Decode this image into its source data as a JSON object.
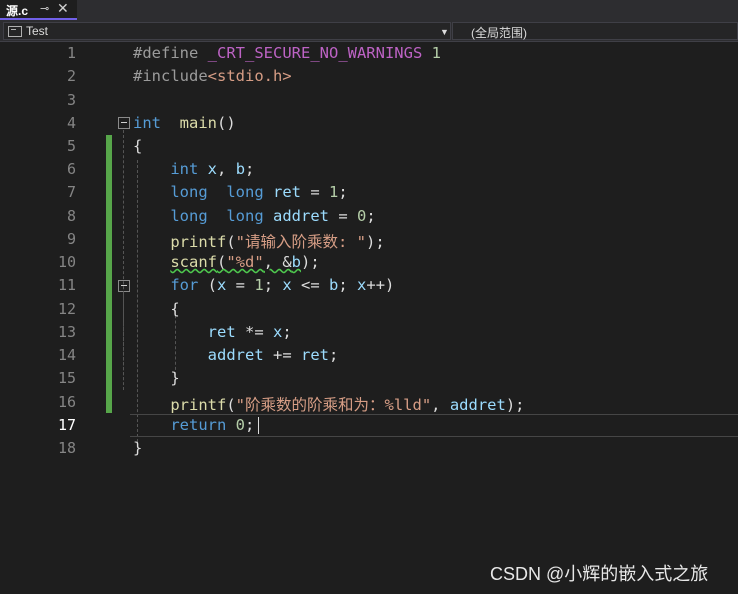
{
  "tab": {
    "title": "源.c",
    "pin": "⊸",
    "close": "✕"
  },
  "nav": {
    "project": "Test",
    "scope": "(全局范围)"
  },
  "line_numbers": [
    "1",
    "2",
    "3",
    "4",
    "5",
    "6",
    "7",
    "8",
    "9",
    "10",
    "11",
    "12",
    "13",
    "14",
    "15",
    "16",
    "17",
    "18"
  ],
  "current_line": "17",
  "code": {
    "l1_define": "#define",
    "l1_macro": "_CRT_SECURE_NO_WARNINGS",
    "l1_val": "1",
    "l2_include": "#include",
    "l2_header": "<stdio.h>",
    "l4_int": "int",
    "l4_main": "main",
    "l4_paren": "()",
    "l5_brace": "{",
    "l6_int": "int",
    "l6_x": "x",
    "l6_comma": ", ",
    "l6_b": "b",
    "l6_semi": ";",
    "l7_long1": "long",
    "l7_long2": "long",
    "l7_ret": "ret",
    "l7_eq": " = ",
    "l7_val": "1",
    "l7_semi": ";",
    "l8_long1": "long",
    "l8_long2": "long",
    "l8_addret": "addret",
    "l8_eq": " = ",
    "l8_val": "0",
    "l8_semi": ";",
    "l9_printf": "printf",
    "l9_open": "(",
    "l9_str": "\"请输入阶乘数: \"",
    "l9_close": ");",
    "l10_scanf": "scanf",
    "l10_open": "(",
    "l10_str": "\"%d\"",
    "l10_comma": ", &",
    "l10_b": "b",
    "l10_close": ");",
    "l11_for": "for",
    "l11_open": " (",
    "l11_x1": "x",
    "l11_eq": " = ",
    "l11_one": "1",
    "l11_semi1": "; ",
    "l11_x2": "x",
    "l11_le": " <= ",
    "l11_b": "b",
    "l11_semi2": "; ",
    "l11_x3": "x",
    "l11_inc": "++)",
    "l12_brace": "{",
    "l13_ret": "ret",
    "l13_op": " *= ",
    "l13_x": "x",
    "l13_semi": ";",
    "l14_addret": "addret",
    "l14_op": " += ",
    "l14_ret": "ret",
    "l14_semi": ";",
    "l15_brace": "}",
    "l16_printf": "printf",
    "l16_open": "(",
    "l16_str": "\"阶乘数的阶乘和为：%lld\"",
    "l16_comma": ", ",
    "l16_addret": "addret",
    "l16_close": ");",
    "l17_return": "return",
    "l17_val": "0",
    "l17_semi": ";",
    "l18_brace": "}"
  },
  "watermark": "CSDN @小辉的嵌入式之旅"
}
